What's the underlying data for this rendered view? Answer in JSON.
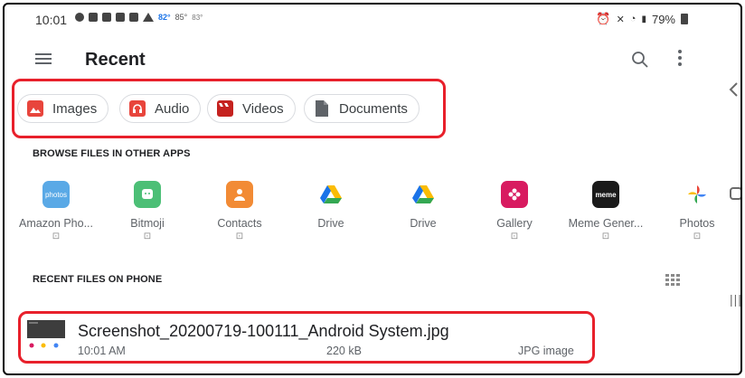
{
  "status_bar": {
    "time": "10:01",
    "temp_1": "82°",
    "temp_2": "85°",
    "temp_3": "83°",
    "battery": "79%"
  },
  "app_bar": {
    "title": "Recent"
  },
  "chips": [
    {
      "label": "Images",
      "icon": "image-icon"
    },
    {
      "label": "Audio",
      "icon": "headphones-icon"
    },
    {
      "label": "Videos",
      "icon": "clapperboard-icon"
    },
    {
      "label": "Documents",
      "icon": "document-icon"
    }
  ],
  "browse_section": {
    "label": "BROWSE FILES IN OTHER APPS",
    "apps": [
      {
        "name": "Amazon Pho...",
        "icon_label": "photos",
        "color": "#5aa9e6"
      },
      {
        "name": "Bitmoji",
        "color": "#4cbf76"
      },
      {
        "name": "Contacts",
        "color": "#f28b35"
      },
      {
        "name": "Drive",
        "color": "#fbbc04"
      },
      {
        "name": "Drive",
        "color": "#fbbc04"
      },
      {
        "name": "Gallery",
        "color": "#d81b60"
      },
      {
        "name": "Meme Gener...",
        "icon_label": "meme",
        "color": "#1a1a1a"
      },
      {
        "name": "Photos",
        "color": "#ea4335"
      }
    ],
    "app_sub_glyph": "⊡"
  },
  "recent_section": {
    "label": "RECENT FILES ON PHONE"
  },
  "file": {
    "name": "Screenshot_20200719-100111_Android System.jpg",
    "time": "10:01 AM",
    "size": "220 kB",
    "type": "JPG image"
  },
  "colors": {
    "highlight": "#e8202b",
    "chip_icon_red": "#e8453c"
  }
}
